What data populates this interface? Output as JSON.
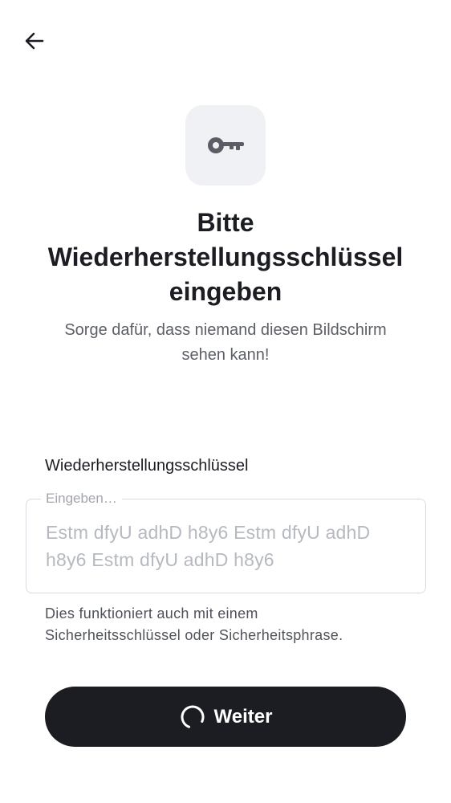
{
  "header": {
    "back_icon": "arrow-left-icon"
  },
  "hero": {
    "icon": "key-icon",
    "title_line1": "Bitte",
    "title_line2": "Wiederherstellungsschlüssel",
    "title_line3": "eingeben",
    "subtitle_line1": "Sorge dafür, dass niemand diesen Bildschirm",
    "subtitle_line2": "sehen kann!"
  },
  "form": {
    "label": "Wiederherstellungsschlüssel",
    "legend": "Eingeben…",
    "placeholder_line1": "Estm dfyU adhD h8y6 Estm dfyU adhD",
    "placeholder_line2": "h8y6 Estm dfyU adhD h8y6",
    "helper_line1": "Dies funktioniert auch mit einem",
    "helper_line2": "Sicherheitsschlüssel oder Sicherheitsphrase."
  },
  "actions": {
    "continue_label": "Weiter",
    "loading_icon": "spinner-icon"
  },
  "colors": {
    "primary": "#1c1d22",
    "tile_background": "#f0f1f5",
    "icon": "#5a5d65",
    "placeholder": "#b6b9bf",
    "border": "#d9dbe0"
  }
}
